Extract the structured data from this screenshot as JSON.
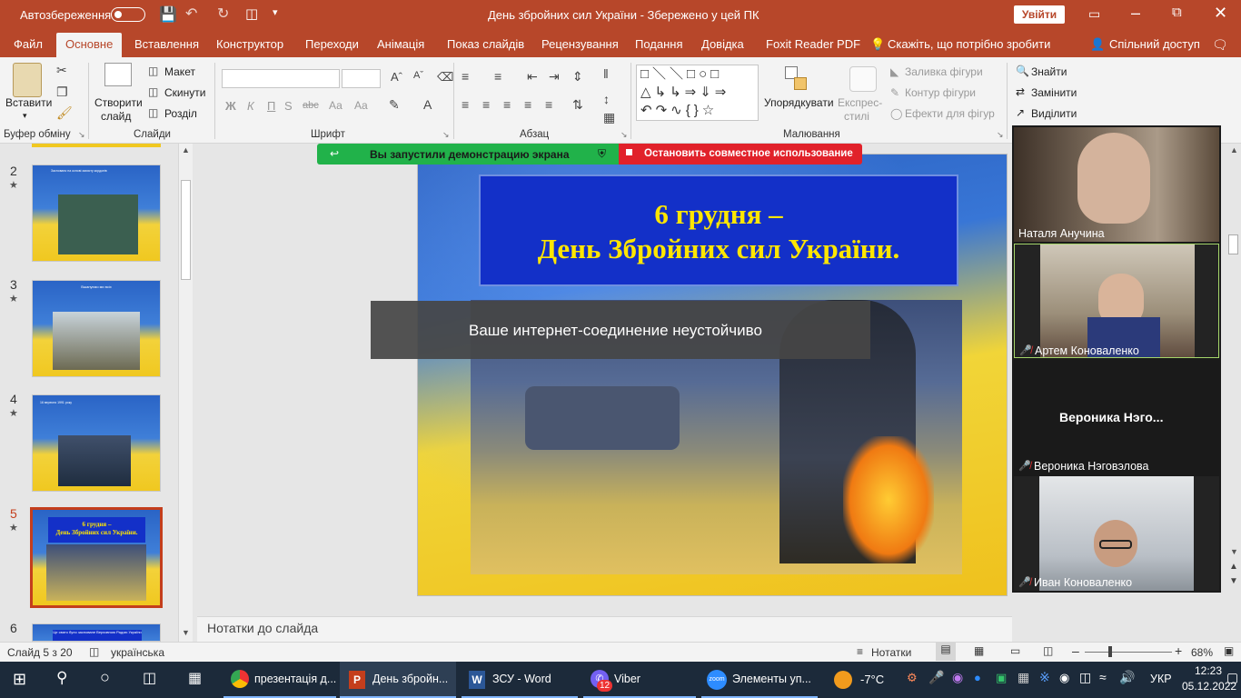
{
  "titlebar": {
    "autosave_label": "Автозбереження",
    "autosave_state": "off",
    "title": "День збройних сил України  -  Збережено у цей ПК",
    "signin_label": "Увійти",
    "save_icon": "save-icon",
    "undo_icon": "undo-icon",
    "redo_icon": "redo-icon"
  },
  "menu": {
    "tabs": [
      "Файл",
      "Основне",
      "Вставлення",
      "Конструктор",
      "Переходи",
      "Анімація",
      "Показ слайдів",
      "Рецензування",
      "Подання",
      "Довідка",
      "Foxit Reader PDF"
    ],
    "active": "Основне",
    "tell_me": "Скажіть, що потрібно зробити",
    "share": "Спільний доступ"
  },
  "ribbon": {
    "clipboard": {
      "paste": "Вставити",
      "label": "Буфер обміну"
    },
    "slides": {
      "new_slide_1": "Створити",
      "new_slide_2": "слайд",
      "layout": "Макет",
      "reset": "Скинути",
      "section": "Розділ",
      "label": "Слайди"
    },
    "font": {
      "label": "Шрифт",
      "bold": "Ж",
      "italic": "К",
      "underline": "П",
      "strike": "abc",
      "shadow": "S",
      "spacing": "Аа",
      "font_case": "Aa"
    },
    "paragraph": {
      "label": "Абзац"
    },
    "drawing": {
      "arrange": "Упорядкувати",
      "quick_styles_1": "Експрес-",
      "quick_styles_2": "стилі",
      "fill": "Заливка фігури",
      "outline": "Контур фігури",
      "effects": "Ефекти для фігур",
      "label": "Малювання"
    },
    "editing": {
      "find": "Знайти",
      "replace": "Замінити",
      "select": "Виділити"
    }
  },
  "screenshare": {
    "status": "Вы запустили демонстрацию экрана",
    "stop": "Остановить совместное использование"
  },
  "thumbnails": [
    {
      "num": "2",
      "text": "Засновано на основі захисту кордонів"
    },
    {
      "num": "3",
      "text": "Вшануємо ми всіх"
    },
    {
      "num": "4",
      "text": "16 вересня 1991 року"
    },
    {
      "num": "5",
      "text_1": "6 грудня –",
      "text_2": "День Збройних сил України."
    },
    {
      "num": "6",
      "text": "Це свято було засноване Верховною Радою України"
    }
  ],
  "selected_slide": "5",
  "slide": {
    "title_line1": "6 грудня –",
    "title_line2": "День Збройних сил України."
  },
  "toast": "Ваше интернет-соединение неустойчиво",
  "notes_placeholder": "Нотатки до слайда",
  "status": {
    "slide_counter": "Слайд 5 з 20",
    "language": "українська",
    "notes_btn": "Нотатки",
    "zoom": "68%"
  },
  "participants": [
    {
      "name": "Наталя Анучина",
      "muted": false,
      "video": true
    },
    {
      "name": "Артем Коноваленко",
      "muted": true,
      "video": true
    },
    {
      "name": "Вероника Нэговэлова",
      "display": "Вероника  Нэго...",
      "muted": true,
      "video": false
    },
    {
      "name": "Иван Коноваленко",
      "muted": true,
      "video": true
    }
  ],
  "taskbar": {
    "apps": [
      {
        "label": "презентація д...",
        "icon": "chrome-icon"
      },
      {
        "label": "День збройн...",
        "icon": "powerpoint-icon",
        "active": true
      },
      {
        "label": "ЗСУ - Word",
        "icon": "word-icon"
      },
      {
        "label": "Viber",
        "icon": "viber-icon",
        "badge": "12"
      },
      {
        "label": "Элементы уп...",
        "icon": "zoom-icon"
      }
    ],
    "weather": "-7°C",
    "lang": "УКР",
    "time": "12:23",
    "date": "05.12.2022"
  },
  "colors": {
    "accent": "#b7472a",
    "slide_banner": "#1330c8",
    "title_yellow": "#ffe600",
    "share_green": "#21b24a",
    "share_red": "#e1212a"
  }
}
